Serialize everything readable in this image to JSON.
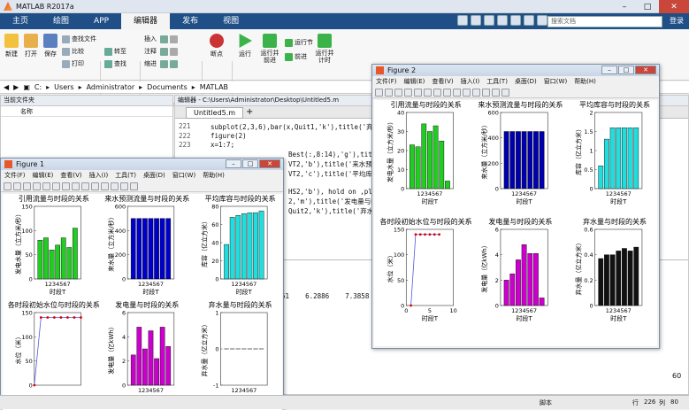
{
  "app": {
    "title": "MATLAB R2017a",
    "search_placeholder": "搜索文档",
    "sign_in": "登录"
  },
  "tabs": [
    "主页",
    "绘图",
    "APP",
    "编辑器",
    "发布",
    "视图"
  ],
  "active_tab": "编辑器",
  "ribbon": {
    "big": [
      {
        "label": "新建",
        "icon": "new-icon"
      },
      {
        "label": "打开",
        "icon": "open-icon"
      },
      {
        "label": "保存",
        "icon": "save-icon"
      },
      {
        "label": "断点",
        "icon": "breakpoint-icon"
      },
      {
        "label": "运行",
        "icon": "run-icon"
      },
      {
        "label": "运行并\n前进",
        "icon": "run-advance-icon"
      },
      {
        "label": "运行并\n计时",
        "icon": "run-time-icon"
      }
    ],
    "small": [
      "查找文件",
      "比较",
      "打印",
      "转至",
      "查找",
      "插入",
      "注释",
      "缩进",
      "运行节",
      "前进"
    ],
    "groups": [
      "文件",
      "导航",
      "编辑",
      "断点",
      "运行"
    ]
  },
  "address": {
    "path": [
      "C:",
      "Users",
      "Administrator",
      "Documents",
      "MATLAB"
    ]
  },
  "current_folder": {
    "title": "当前文件夹",
    "column": "名称"
  },
  "editor": {
    "title": "编辑器 - C:\\Users\\Administrator\\Desktop\\Untitled5.m",
    "tab": "Untitled5.m",
    "lines": [
      {
        "n": "221",
        "text": "subplot(2,3,6),bar(x,Quit1,'k'),title('弃水量与"
      },
      {
        "n": "222",
        "text": "figure(2)"
      },
      {
        "n": "223",
        "text": "x=1:7;"
      },
      {
        "n": "",
        "text": "Best(:,8:14),'g'),title('"
      },
      {
        "n": "",
        "text": "VT2,'b'),title('来水预测流"
      },
      {
        "n": "",
        "text": "VT2,'c'),title('平均库容与"
      },
      {
        "n": "",
        "text": ""
      },
      {
        "n": "",
        "text": "HS2,'b'), hold on ,plot("
      },
      {
        "n": "",
        "text": "2,'m'),title('发电量与时"
      },
      {
        "n": "",
        "text": "Quit2,'k'),title('弃水量与"
      }
    ],
    "output": [
      "51    6.2886    7.3858"
    ]
  },
  "status": {
    "mode": "脚本",
    "row_label": "行",
    "row": "226",
    "col_label": "列",
    "col": "80",
    "zoom": "60"
  },
  "figure1": {
    "title": "Figure 1",
    "menu": [
      "文件(F)",
      "编辑(E)",
      "查看(V)",
      "插入(I)",
      "工具(T)",
      "桌面(D)",
      "窗口(W)",
      "帮助(H)"
    ],
    "plots": [
      {
        "title": "引用流量与时段的关系",
        "ylabel": "发电水量（立方米/秒）",
        "xlabel": "时段T"
      },
      {
        "title": "来水预测流量与时段的关系",
        "ylabel": "来水量（立方米/秒）",
        "xlabel": "时段T"
      },
      {
        "title": "平均库容与时段的关系",
        "ylabel": "库容（亿立方米）",
        "xlabel": "时段T"
      },
      {
        "title": "各时段初始水位与时段的关系",
        "ylabel": "水位（米）",
        "xlabel": ""
      },
      {
        "title": "发电量与时段的关系",
        "ylabel": "发电量（亿kWh）",
        "xlabel": ""
      },
      {
        "title": "弃水量与时段的关系",
        "ylabel": "弃水量（亿立方米）",
        "xlabel": ""
      }
    ]
  },
  "figure2": {
    "title": "Figure 2",
    "menu": [
      "文件(F)",
      "编辑(E)",
      "查看(V)",
      "插入(I)",
      "工具(T)",
      "桌面(D)",
      "窗口(W)",
      "帮助(H)"
    ],
    "plots": [
      {
        "title": "引用流量与时段的关系",
        "ylabel": "发电水量（立方米/秒）",
        "xlabel": "时段T"
      },
      {
        "title": "来水预测流量与时段的关系",
        "ylabel": "来水量（立方米/秒）",
        "xlabel": "时段T"
      },
      {
        "title": "平均库容与时段的关系",
        "ylabel": "库容（亿立方米）",
        "xlabel": "时段T"
      },
      {
        "title": "各时段初始水位与时段的关系",
        "ylabel": "水位（米）",
        "xlabel": "时段T"
      },
      {
        "title": "发电量与时段的关系",
        "ylabel": "发电量（亿kWh）",
        "xlabel": "时段T"
      },
      {
        "title": "弃水量与时段的关系",
        "ylabel": "弃水量（亿立方米）",
        "xlabel": "时段T"
      }
    ]
  },
  "chart_data": [
    {
      "type": "bar",
      "figure": "Figure 1",
      "title": "引用流量与时段的关系",
      "categories": [
        "1",
        "2",
        "3",
        "4",
        "5",
        "6",
        "7"
      ],
      "values": [
        80,
        85,
        60,
        70,
        85,
        65,
        105
      ],
      "ylim": [
        0,
        150
      ],
      "yticks": [
        0,
        50,
        100,
        150
      ],
      "color": "#22cc22"
    },
    {
      "type": "bar",
      "figure": "Figure 1",
      "title": "来水预测流量与时段的关系",
      "categories": [
        "1",
        "2",
        "3",
        "4",
        "5",
        "6",
        "7"
      ],
      "values": [
        500,
        500,
        500,
        500,
        500,
        500,
        500
      ],
      "ylim": [
        0,
        600
      ],
      "yticks": [
        0,
        200,
        400,
        600
      ],
      "color": "#0000cc"
    },
    {
      "type": "bar",
      "figure": "Figure 1",
      "title": "平均库容与时段的关系",
      "categories": [
        "1",
        "2",
        "3",
        "4",
        "5",
        "6",
        "7"
      ],
      "values": [
        38,
        68,
        70,
        72,
        73,
        73,
        75
      ],
      "ylim": [
        0,
        80
      ],
      "yticks": [
        0,
        20,
        40,
        60,
        80
      ],
      "color": "#22dddd"
    },
    {
      "type": "line",
      "figure": "Figure 1",
      "title": "各时段初始水位与时段的关系",
      "x": [
        0,
        1,
        2,
        3,
        4,
        5,
        6,
        7
      ],
      "y": [
        0,
        140,
        140,
        140,
        140,
        140,
        140,
        140
      ],
      "ylim": [
        0,
        150
      ],
      "yticks": [
        0,
        50,
        100,
        150
      ],
      "color": "#dd0000"
    },
    {
      "type": "bar",
      "figure": "Figure 1",
      "title": "发电量与时段的关系",
      "categories": [
        "1",
        "2",
        "3",
        "4",
        "5",
        "6",
        "7"
      ],
      "values": [
        2.5,
        4.8,
        3.0,
        4.5,
        2.2,
        4.8,
        3.2
      ],
      "ylim": [
        0,
        6
      ],
      "yticks": [
        0,
        2,
        4,
        6
      ],
      "color": "#cc00cc"
    },
    {
      "type": "bar",
      "figure": "Figure 1",
      "title": "弃水量与时段的关系",
      "categories": [
        "1",
        "2",
        "3",
        "4",
        "5",
        "6",
        "7"
      ],
      "values": [
        0,
        0,
        0,
        0,
        0,
        0,
        0
      ],
      "ylim": [
        -1,
        1
      ],
      "yticks": [
        -1,
        0,
        1
      ],
      "color": "#111111"
    },
    {
      "type": "bar",
      "figure": "Figure 2",
      "title": "引用流量与时段的关系",
      "categories": [
        "1",
        "2",
        "3",
        "4",
        "5",
        "6",
        "7"
      ],
      "values": [
        23,
        22,
        34,
        30,
        33,
        25,
        4
      ],
      "ylim": [
        0,
        40
      ],
      "yticks": [
        0,
        10,
        20,
        30,
        40
      ],
      "color": "#22cc22"
    },
    {
      "type": "bar",
      "figure": "Figure 2",
      "title": "来水预测流量与时段的关系",
      "categories": [
        "1",
        "2",
        "3",
        "4",
        "5",
        "6",
        "7"
      ],
      "values": [
        450,
        450,
        450,
        450,
        450,
        450,
        450
      ],
      "ylim": [
        0,
        600
      ],
      "yticks": [
        0,
        200,
        400,
        600
      ],
      "color": "#0000aa"
    },
    {
      "type": "bar",
      "figure": "Figure 2",
      "title": "平均库容与时段的关系",
      "categories": [
        "1",
        "2",
        "3",
        "4",
        "5",
        "6",
        "7"
      ],
      "values": [
        0.6,
        1.3,
        1.6,
        1.6,
        1.6,
        1.6,
        1.6
      ],
      "ylim": [
        0,
        2
      ],
      "yticks": [
        0,
        0.5,
        1,
        1.5,
        2
      ],
      "color": "#22dddd"
    },
    {
      "type": "line",
      "figure": "Figure 2",
      "title": "各时段初始水位与时段的关系",
      "x": [
        1,
        2,
        3,
        4,
        5,
        6,
        7
      ],
      "y": [
        0,
        140,
        140,
        140,
        140,
        140,
        140
      ],
      "ylim": [
        0,
        150
      ],
      "yticks": [
        0,
        50,
        100,
        150
      ],
      "xticks": [
        0,
        5,
        10
      ],
      "xlim": [
        0,
        10
      ],
      "color": "#dd0000"
    },
    {
      "type": "bar",
      "figure": "Figure 2",
      "title": "发电量与时段的关系",
      "categories": [
        "1",
        "2",
        "3",
        "4",
        "5",
        "6",
        "7"
      ],
      "values": [
        2.0,
        2.5,
        3.6,
        4.8,
        4.1,
        4.1,
        0.6
      ],
      "ylim": [
        0,
        6
      ],
      "yticks": [
        0,
        2,
        4,
        6
      ],
      "color": "#cc00cc"
    },
    {
      "type": "bar",
      "figure": "Figure 2",
      "title": "弃水量与时段的关系",
      "categories": [
        "1",
        "2",
        "3",
        "4",
        "5",
        "6",
        "7"
      ],
      "values": [
        0.37,
        0.4,
        0.4,
        0.43,
        0.45,
        0.43,
        0.46
      ],
      "ylim": [
        0,
        0.6
      ],
      "yticks": [
        0,
        0.2,
        0.4,
        0.6
      ],
      "color": "#111111"
    }
  ]
}
